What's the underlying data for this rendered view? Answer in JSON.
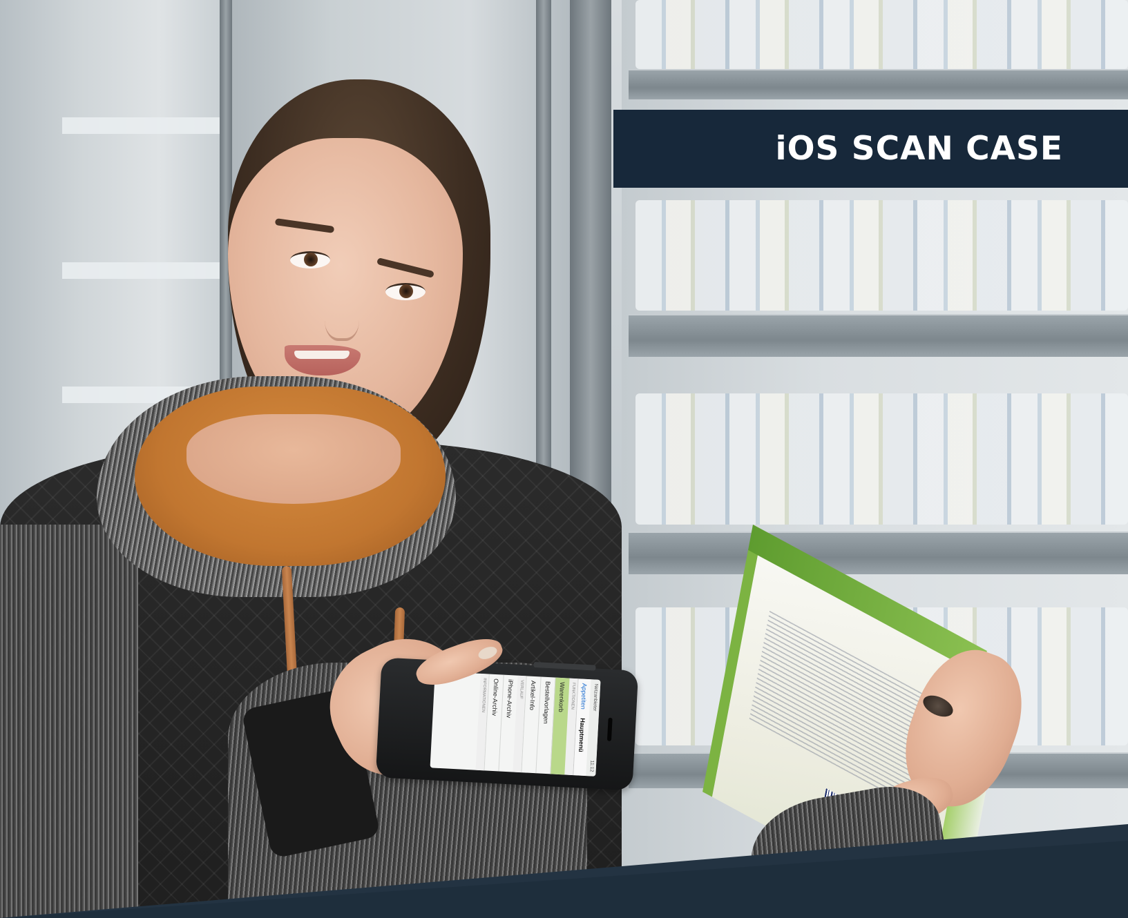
{
  "banner": {
    "title": "iOS SCAN CASE"
  },
  "phone_app": {
    "status_left": "Netzanbieter",
    "status_right": "11:12",
    "nav_back": "Appetiten",
    "nav_title": "Hauptmenü",
    "section_bestellen": "FUNKTIONEN",
    "items_primary": [
      "Warenkorb",
      "Bestellvorlagen",
      "Artikel-Info"
    ],
    "section_verlauf": "VERLAUF",
    "items_secondary": [
      "iPhone-Archiv",
      "Online-Archiv"
    ],
    "section_info": "INFORMATIONEN",
    "active_item_color": "#b9d88a"
  },
  "colors": {
    "banner_bg": "#17283a",
    "banner_text": "#ffffff",
    "bottom_band": "#233342",
    "box_green": "#7cb342"
  }
}
